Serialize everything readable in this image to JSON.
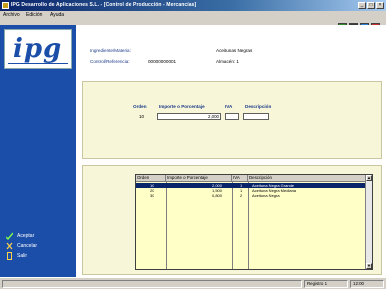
{
  "window": {
    "title": "IPG Desarrollo de Aplicaciones S.L. - [Control de Producción - Mercancías]"
  },
  "menubar": {
    "items": [
      "Archivo",
      "Edición",
      "Ayuda"
    ]
  },
  "toolbar": {
    "icons": [
      "exit-icon",
      "print-icon",
      "calc-icon",
      "help-icon"
    ]
  },
  "logo": {
    "text": "ipg"
  },
  "sidebar": {
    "buttons": [
      {
        "label": "Aceptar",
        "icon": "check-icon"
      },
      {
        "label": "Cancelar",
        "icon": "cancel-icon"
      },
      {
        "label": "Salir",
        "icon": "exit-icon"
      }
    ]
  },
  "info": {
    "label1": "Ingrediente/Materia:",
    "value1": "Aceitunas Negras",
    "label2": "Control/Referencia:",
    "value2": "00000000001",
    "value3": "Almacén: 1"
  },
  "form": {
    "col_orden": "Orden",
    "col_importe": "Importe o Porcentaje",
    "col_iva": "IVA",
    "col_descrip": "Descripción",
    "orden_value": "10",
    "importe_value": "2,000",
    "iva_value": "",
    "descrip_value": ""
  },
  "grid": {
    "headers": [
      "Orden",
      "Importe o Porcentaje",
      "IVA",
      "Descripción"
    ],
    "rows": [
      [
        "10",
        "2,000",
        "1",
        "Aceituna Negra Grande"
      ],
      [
        "20",
        "1,500",
        "1",
        "Aceituna Negra Mediana"
      ],
      [
        "30",
        "0,800",
        "2",
        "Aceituna Negra"
      ]
    ],
    "selected_row": 0
  },
  "statusbar": {
    "left": "",
    "mid": "Registro 1",
    "right": "12:00"
  }
}
